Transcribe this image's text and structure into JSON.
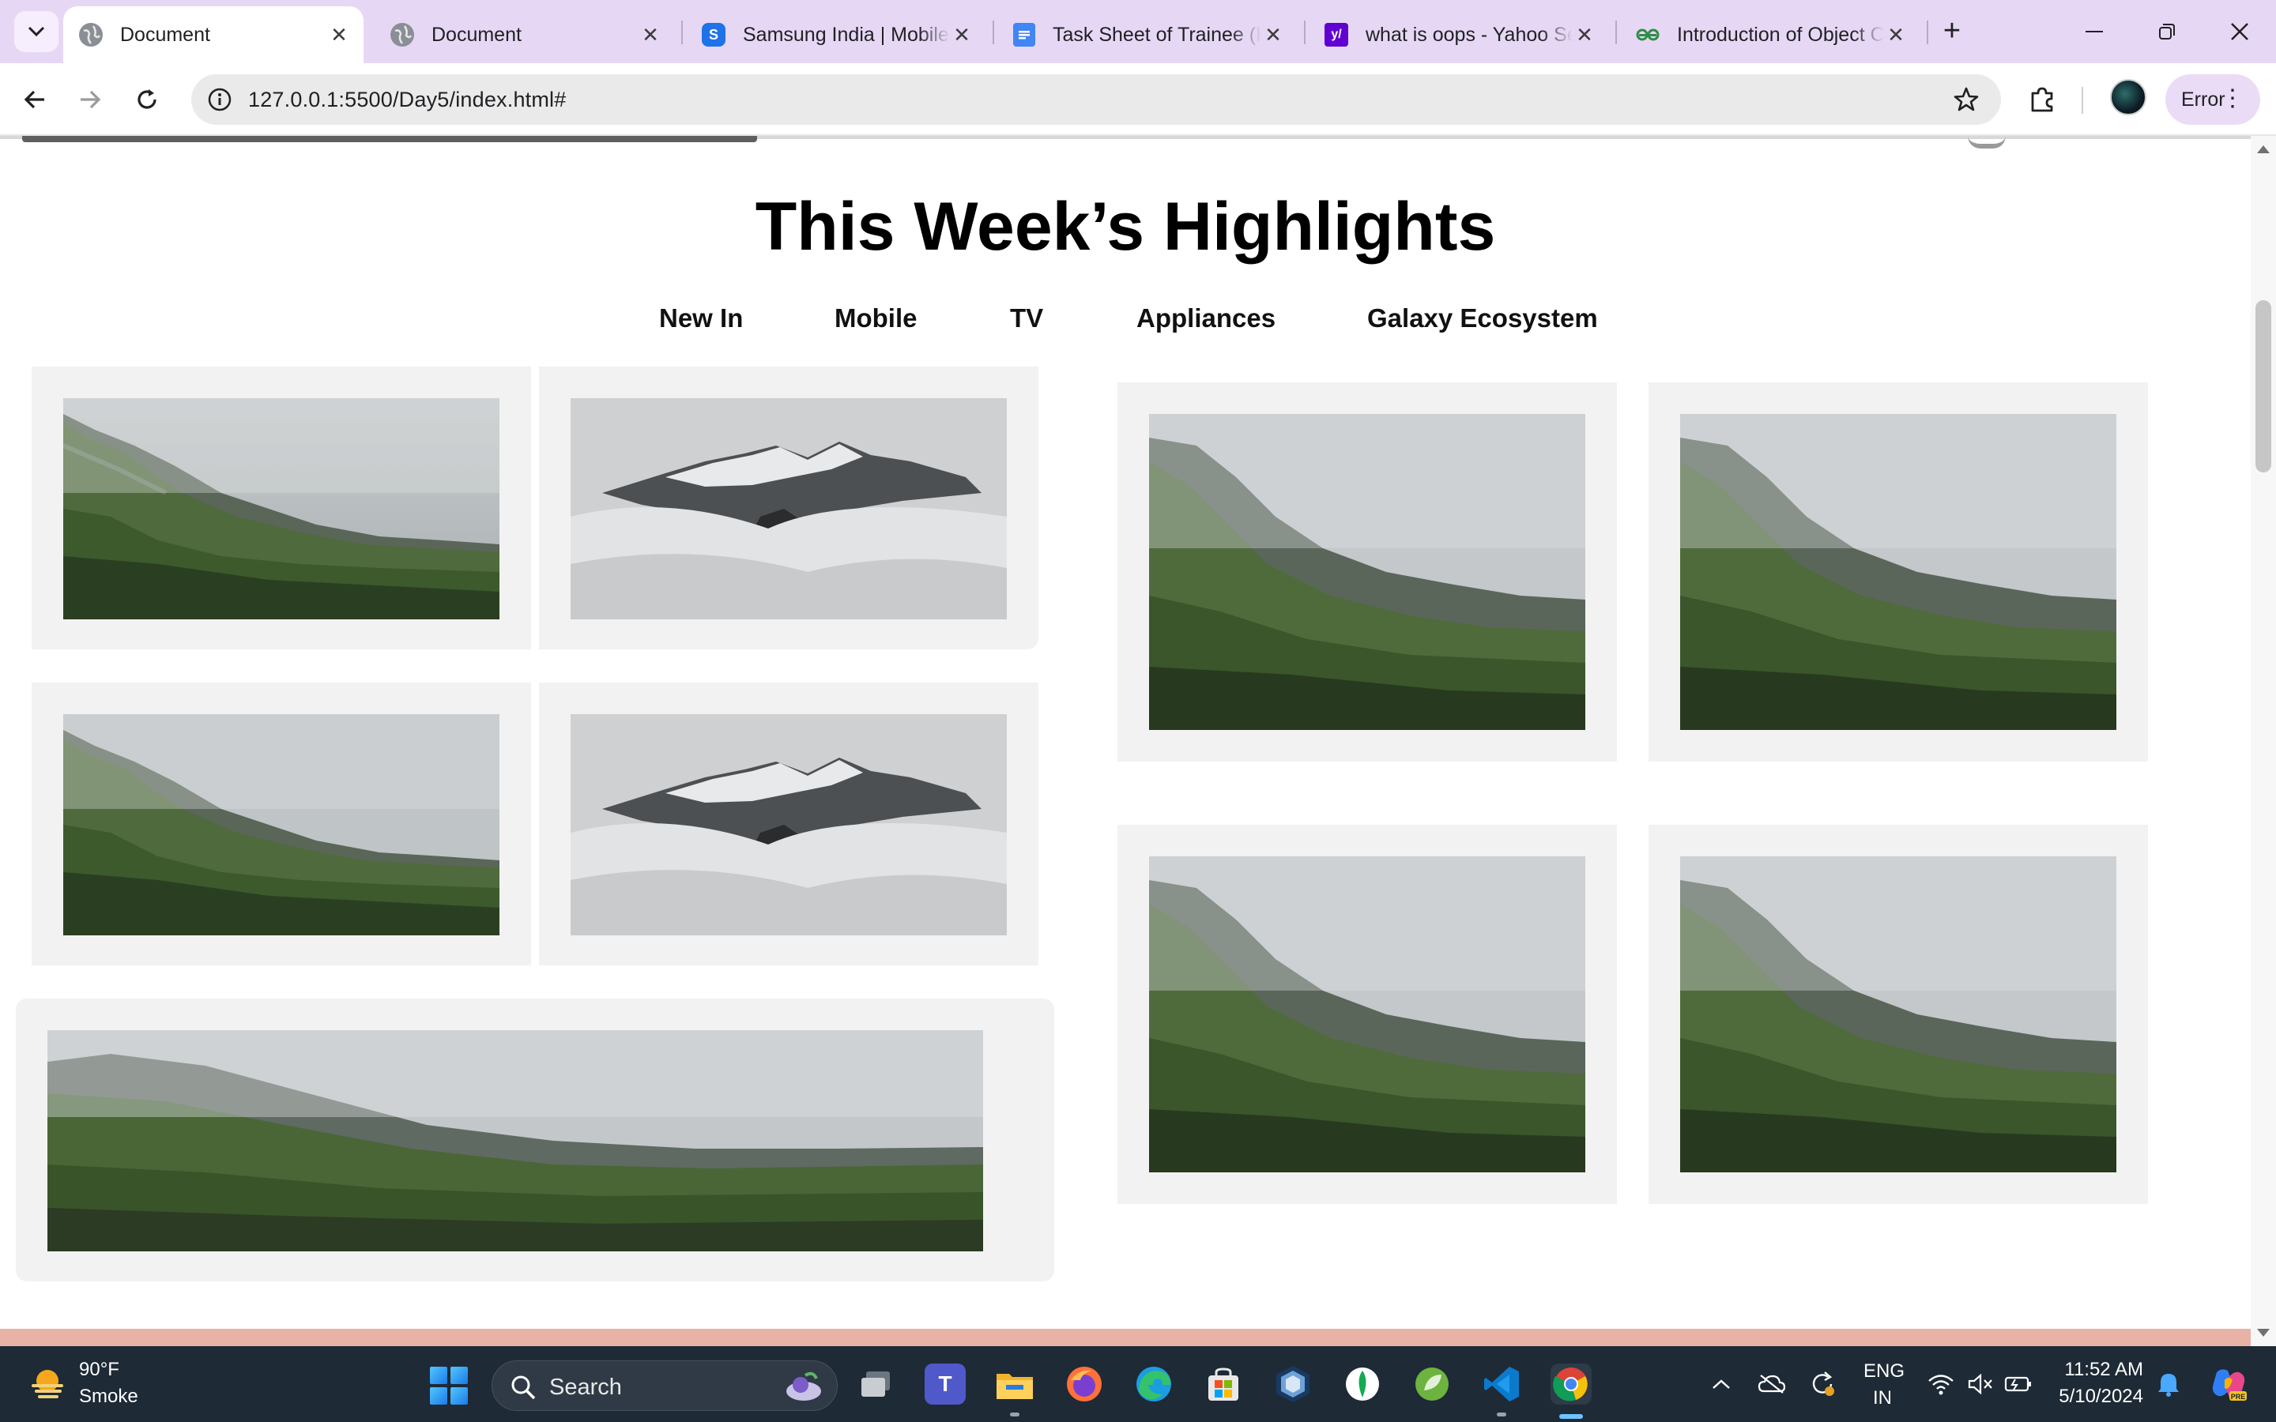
{
  "browser": {
    "tabs": [
      {
        "title": "Document",
        "favicon": "globe-icon",
        "active": true
      },
      {
        "title": "Document",
        "favicon": "globe-icon",
        "active": false
      },
      {
        "title": "Samsung India | Mobile",
        "favicon": "samsung-icon",
        "favicon_letter": "S",
        "active": false
      },
      {
        "title": "Task Sheet of Trainee (H",
        "favicon": "google-docs-icon",
        "active": false
      },
      {
        "title": "what is oops - Yahoo Se",
        "favicon": "yahoo-icon",
        "favicon_letter": "y/",
        "active": false
      },
      {
        "title": "Introduction of Object C",
        "favicon": "geeksforgeeks-icon",
        "active": false
      }
    ],
    "url": "127.0.0.1:5500/Day5/index.html#",
    "profile_button_label": "Error",
    "colors": {
      "tabbar": "#e6d8f5",
      "omnibox": "#eaeaea",
      "profile_button": "#eadcf7"
    }
  },
  "page": {
    "heading": "This Week’s Highlights",
    "nav": [
      "New In",
      "Mobile",
      "TV",
      "Appliances",
      "Galaxy Ecosystem"
    ],
    "cards": [
      {
        "image": "misty-green-mountain"
      },
      {
        "image": "snowy-peak-in-clouds"
      },
      {
        "image": "misty-green-mountain"
      },
      {
        "image": "snowy-peak-in-clouds"
      },
      {
        "image": "misty-green-mountain-wide"
      },
      {
        "image": "misty-green-mountain"
      },
      {
        "image": "misty-green-mountain"
      },
      {
        "image": "misty-green-mountain"
      },
      {
        "image": "misty-green-mountain"
      }
    ],
    "colors": {
      "card": "#f2f2f2",
      "bottom_band": "#e9b2a6"
    }
  },
  "taskbar": {
    "weather": {
      "temp": "90°F",
      "desc": "Smoke"
    },
    "search_label": "Search",
    "apps": [
      "task-view-icon",
      "teams-icon",
      "file-explorer-icon",
      "firefox-icon",
      "edge-icon",
      "microsoft-store-icon",
      "virtualbox-icon",
      "mongodb-compass-icon",
      "spring-tools-icon",
      "vscode-icon",
      "chrome-icon"
    ],
    "language": {
      "line1": "ENG",
      "line2": "IN"
    },
    "clock": {
      "time": "11:52 AM",
      "date": "5/10/2024"
    }
  }
}
